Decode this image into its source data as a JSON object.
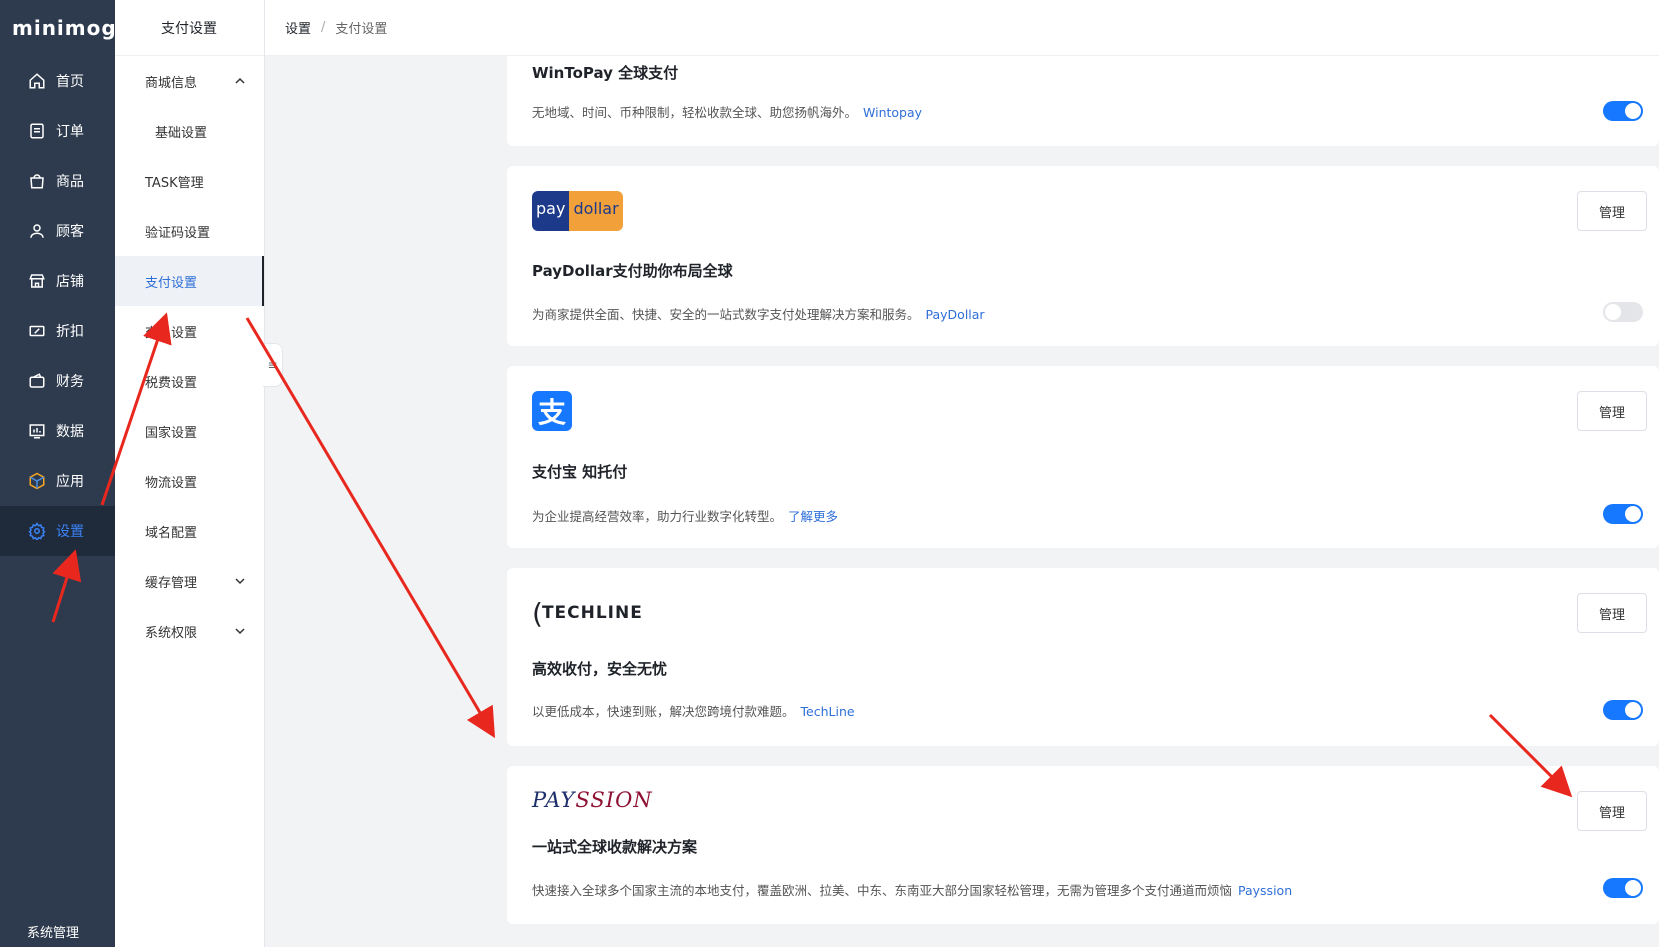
{
  "app": {
    "logo": "minimog"
  },
  "sidebar": {
    "items": [
      {
        "label": "首页",
        "icon": "home-icon"
      },
      {
        "label": "订单",
        "icon": "order-icon"
      },
      {
        "label": "商品",
        "icon": "bag-icon"
      },
      {
        "label": "顾客",
        "icon": "user-icon"
      },
      {
        "label": "店铺",
        "icon": "store-icon"
      },
      {
        "label": "折扣",
        "icon": "discount-icon"
      },
      {
        "label": "财务",
        "icon": "wallet-icon"
      },
      {
        "label": "数据",
        "icon": "chart-icon"
      },
      {
        "label": "应用",
        "icon": "cube-icon"
      },
      {
        "label": "设置",
        "icon": "gear-icon",
        "active": true
      }
    ],
    "footer": "系统管理"
  },
  "subnav": {
    "title": "支付设置",
    "items": [
      {
        "label": "商城信息"
      },
      {
        "label": "基础设置"
      },
      {
        "label": "TASK管理"
      },
      {
        "label": "验证码设置"
      },
      {
        "label": "支付设置"
      },
      {
        "label": "交易设置"
      },
      {
        "label": "税费设置"
      },
      {
        "label": "国家设置"
      },
      {
        "label": "物流设置"
      },
      {
        "label": "域名配置"
      },
      {
        "label": "缓存管理"
      },
      {
        "label": "系统权限"
      }
    ]
  },
  "breadcrumb": {
    "parent": "设置",
    "separator": "/",
    "current": "支付设置"
  },
  "manage_label": "管理",
  "cards": {
    "wintopay": {
      "title": "WinToPay 全球支付",
      "desc": "无地域、时间、币种限制，轻松收款全球、助您扬帆海外。",
      "link": "Wintopay",
      "enabled": true
    },
    "paydollar": {
      "logo_a": "pay",
      "logo_b": "dollar",
      "title": "PayDollar支付助你布局全球",
      "desc": "为商家提供全面、快捷、安全的一站式数字支付处理解决方案和服务。",
      "link": "PayDollar",
      "enabled": false
    },
    "alipay": {
      "logo": "支",
      "title": "支付宝 知托付",
      "desc": "为企业提高经营效率，助力行业数字化转型。",
      "link": "了解更多",
      "enabled": true
    },
    "techline": {
      "logo": "TECHLINE",
      "title": "高效收付，安全无忧",
      "desc": "以更低成本，快速到账，解决您跨境付款难题。",
      "link": "TechLine",
      "enabled": true
    },
    "payssion": {
      "logo_a": "PAY",
      "logo_b": "SSION",
      "title": "一站式全球收款解决方案",
      "desc": "快速接入全球多个国家主流的本地支付，覆盖欧洲、拉美、中东、东南亚大部分国家轻松管理，无需为管理多个支付通道而烦恼",
      "link": "Payssion",
      "enabled": true
    }
  },
  "colors": {
    "sidebar_bg": "#2e3b4e",
    "accent": "#1677ff",
    "link": "#2f6fd8",
    "annotation": "#e8281e"
  }
}
